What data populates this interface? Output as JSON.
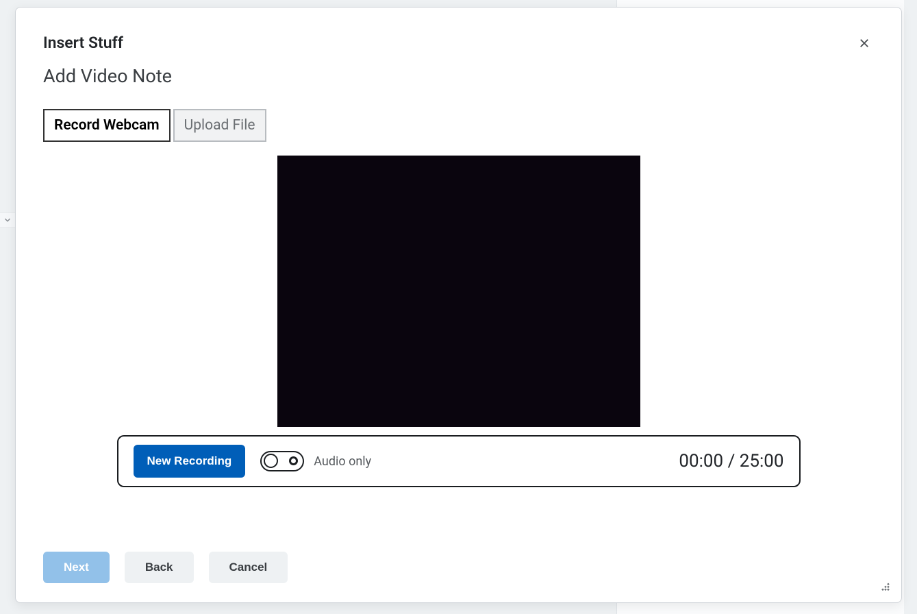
{
  "modal": {
    "title": "Insert Stuff",
    "subtitle": "Add Video Note"
  },
  "tabs": {
    "record": "Record Webcam",
    "upload": "Upload File"
  },
  "controls": {
    "new_recording": "New Recording",
    "audio_only": "Audio only",
    "time": "00:00 / 25:00"
  },
  "footer": {
    "next": "Next",
    "back": "Back",
    "cancel": "Cancel"
  }
}
